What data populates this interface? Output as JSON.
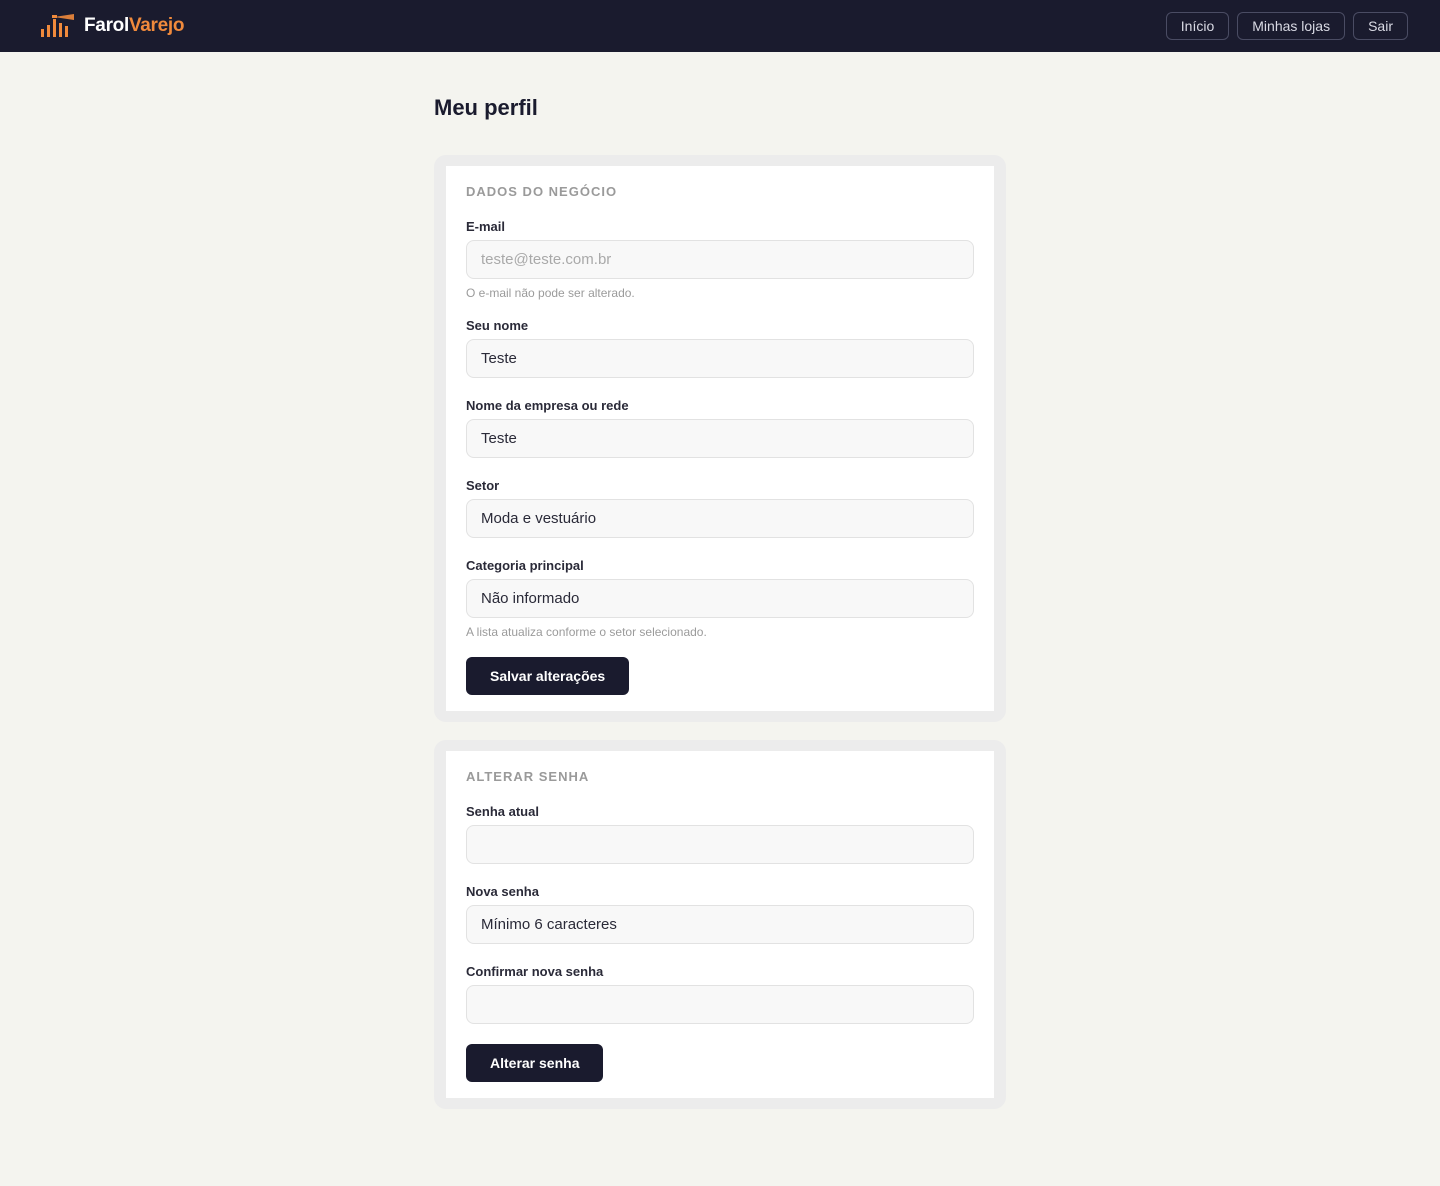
{
  "brand": {
    "part1": "Farol",
    "part2": "Varejo",
    "icon": "lighthouse-bars-icon",
    "accent": "#f08a3c",
    "dark": "#1a1b2e"
  },
  "nav": {
    "home": "Início",
    "stores": "Minhas lojas",
    "logout": "Sair"
  },
  "page": {
    "title": "Meu perfil"
  },
  "business": {
    "title": "DADOS DO NEGÓCIO",
    "email": {
      "label": "E-mail",
      "value": "teste@teste.com.br",
      "hint": "O e-mail não pode ser alterado."
    },
    "name": {
      "label": "Seu nome",
      "value": "Teste"
    },
    "company": {
      "label": "Nome da empresa ou rede",
      "value": "Teste"
    },
    "sector": {
      "label": "Setor",
      "value": "Moda e vestuário"
    },
    "category": {
      "label": "Categoria principal",
      "value": "Não informado",
      "hint": "A lista atualiza conforme o setor selecionado."
    },
    "save_label": "Salvar alterações"
  },
  "password": {
    "title": "ALTERAR SENHA",
    "current": {
      "label": "Senha atual",
      "value": ""
    },
    "new": {
      "label": "Nova senha",
      "placeholder": "Mínimo 6 caracteres"
    },
    "confirm": {
      "label": "Confirmar nova senha",
      "value": ""
    },
    "submit_label": "Alterar senha"
  }
}
